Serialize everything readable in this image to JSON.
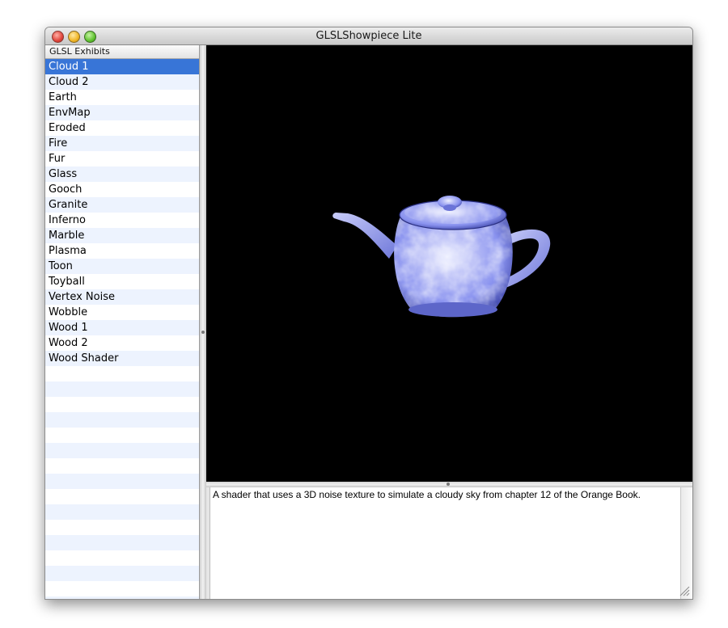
{
  "window": {
    "title": "GLSLShowpiece Lite"
  },
  "sidebar": {
    "header": "GLSL Exhibits",
    "selected_index": 0,
    "items": [
      "Cloud 1",
      "Cloud 2",
      "Earth",
      "EnvMap",
      "Eroded",
      "Fire",
      "Fur",
      "Glass",
      "Gooch",
      "Granite",
      "Inferno",
      "Marble",
      "Plasma",
      "Toon",
      "Toyball",
      "Vertex Noise",
      "Wobble",
      "Wood 1",
      "Wood 2",
      "Wood Shader"
    ]
  },
  "viewport": {
    "subject": "teapot-render",
    "background": "#000000",
    "tint": "#8a93ef"
  },
  "description": {
    "text": "A shader that uses a 3D noise texture to simulate a cloudy sky from chapter 12 of the Orange Book."
  },
  "colors": {
    "selection": "#3875d7",
    "stripe": "#edf3fe"
  }
}
